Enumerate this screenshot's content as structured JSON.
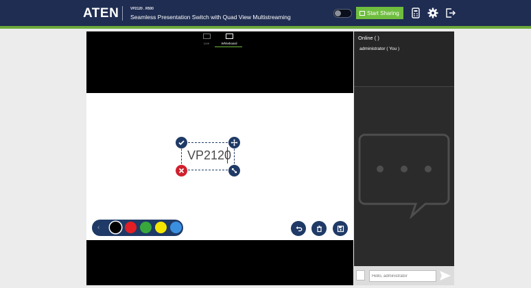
{
  "header": {
    "logo": "ATEN",
    "model": "VP2120 . R500",
    "product": "Seamless Presentation Switch with Quad View Multistreaming",
    "share_label": "Start Sharing",
    "icons": [
      "remote-icon",
      "gear-icon",
      "logout-icon"
    ]
  },
  "modes": {
    "live": "Live",
    "whiteboard": "Whiteboard",
    "active": "Whiteboard"
  },
  "whiteboard": {
    "text_value": "VP2120"
  },
  "palette": {
    "colors": [
      "#000000",
      "#e31e24",
      "#38a83c",
      "#f5e600",
      "#3b8fe0"
    ],
    "selected": "#000000"
  },
  "tools": [
    "undo-icon",
    "trash-icon",
    "save-icon"
  ],
  "panel": {
    "online_title": "Online ( )",
    "online_user": "administrator ( You )",
    "chat_placeholder": "Hello, administrator"
  },
  "colors": {
    "header_bg": "#1f2d52",
    "accent_green": "#6fbe3f",
    "handle_blue": "#1f3a66",
    "handle_red": "#d0202e"
  }
}
